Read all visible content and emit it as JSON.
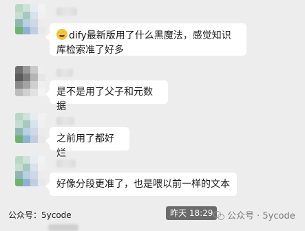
{
  "messages": [
    {
      "text": "dify最新版用了什么黑魔法，感觉知识库检索准了好多",
      "emoji": "grinning-sweat-emoji"
    },
    {
      "text": "是不是用了父子和元数据"
    },
    {
      "text": "之前用了都好烂"
    },
    {
      "text": "好像分段更准了，也是喂以前一样的文本"
    }
  ],
  "footer": {
    "left_watermark": "公众号：5ycode",
    "timestamp": "昨天 18:29",
    "right_watermark": "公众号 · 5ycode"
  },
  "colors": {
    "background": "#ededed",
    "bubble": "#ffffff",
    "timestamp_bg": "#6b6b6b"
  }
}
